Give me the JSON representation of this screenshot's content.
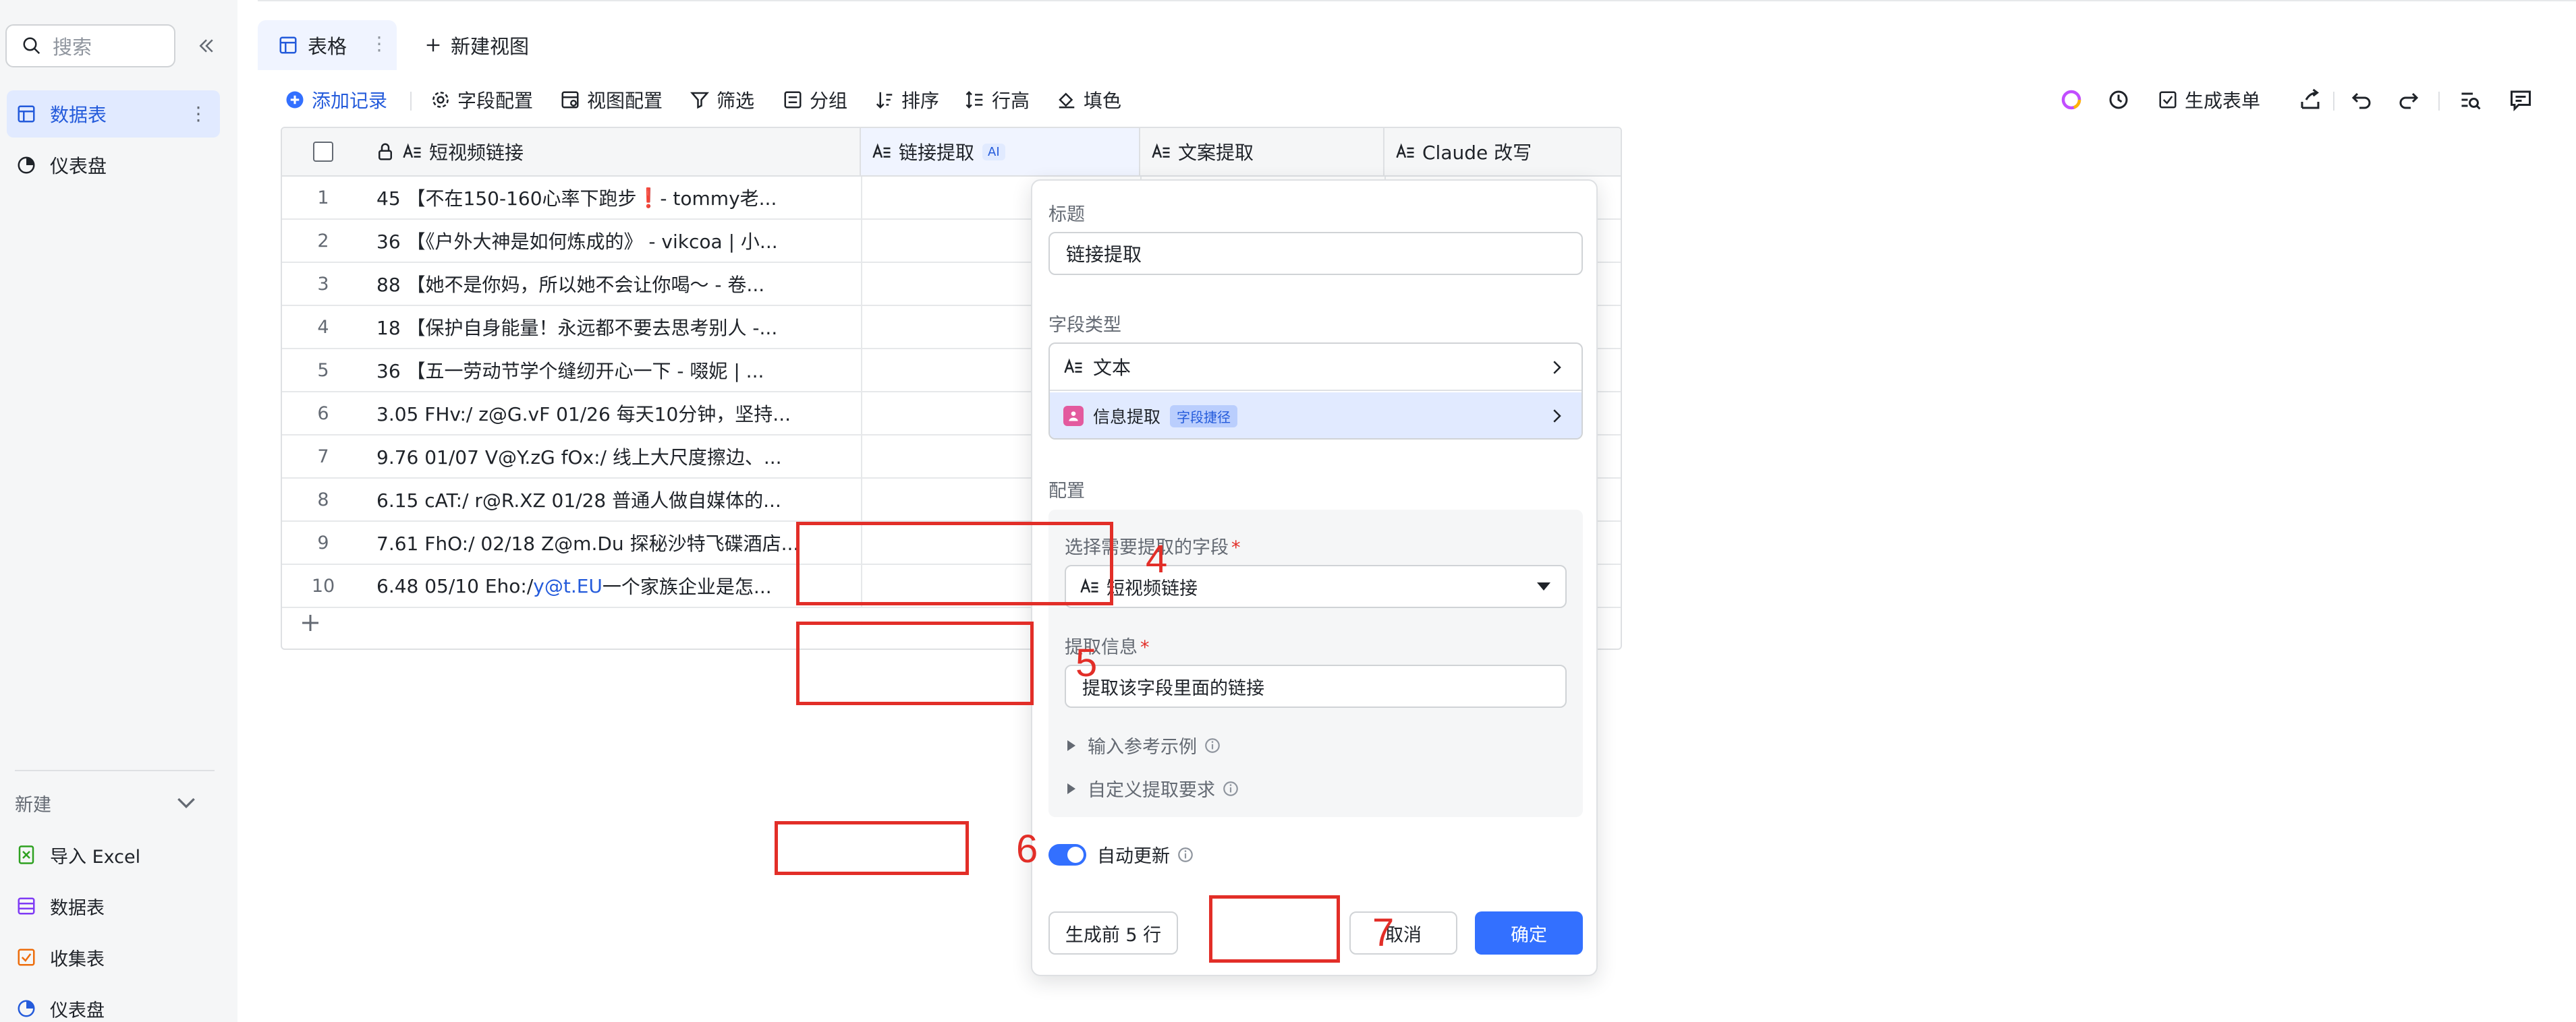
{
  "sidebar": {
    "search_placeholder": "搜索",
    "items": [
      {
        "label": "数据表",
        "active": true
      },
      {
        "label": "仪表盘",
        "active": false
      }
    ],
    "new_section": {
      "label": "新建",
      "items": [
        {
          "label": "导入 Excel",
          "icon": "excel-icon"
        },
        {
          "label": "数据表",
          "icon": "table-icon"
        },
        {
          "label": "收集表",
          "icon": "form-icon"
        },
        {
          "label": "仪表盘",
          "icon": "dashboard-icon"
        }
      ]
    }
  },
  "tabs": {
    "active": "表格",
    "new_view": "新建视图"
  },
  "toolbar": {
    "add_record": "添加记录",
    "field_config": "字段配置",
    "view_config": "视图配置",
    "filter": "筛选",
    "group": "分组",
    "sort": "排序",
    "row_height": "行高",
    "fill": "填色",
    "generate_form": "生成表单"
  },
  "table": {
    "columns": [
      "短视频链接",
      "链接提取",
      "文案提取",
      "Claude 改写"
    ],
    "ai_badge": "AI",
    "rows": [
      {
        "num": "1",
        "text": "45 【不在150-160心率下跑步",
        "excl": "❗",
        "tail": " - tommy老..."
      },
      {
        "num": "2",
        "text": "36 【《户外大神是如何炼成的》 - vikcoa | 小..."
      },
      {
        "num": "3",
        "text": "88 【她不是你妈，所以她不会让你喝～ - 卷..."
      },
      {
        "num": "4",
        "text": "18 【保护自身能量！永远都不要去思考别人 -..."
      },
      {
        "num": "5",
        "text": "36 【五一劳动节学个缝纫开心一下 - 啜妮 | ..."
      },
      {
        "num": "6",
        "text": "3.05 FHv:/ z@G.vF 01/26 每天10分钟，坚持..."
      },
      {
        "num": "7",
        "text": "9.76 01/07 V@Y.zG fOx:/ 线上大尺度擦边、..."
      },
      {
        "num": "8",
        "text": "6.15 cAT:/ r@R.XZ 01/28 普通人做自媒体的..."
      },
      {
        "num": "9",
        "text": "7.61 FhO:/ 02/18 Z@m.Du 探秘沙特飞碟酒店..."
      },
      {
        "num": "10",
        "text": "6.48 05/10 Eho:/ ",
        "link": "y@t.EU",
        "tail": " 一个家族企业是怎..."
      }
    ]
  },
  "panel": {
    "title_label": "标题",
    "title_value": "链接提取",
    "type_label": "字段类型",
    "type_text": "文本",
    "type_extract": "信息提取",
    "type_badge": "字段捷径",
    "config_label": "配置",
    "select_field_label": "选择需要提取的字段",
    "select_field_value": "短视频链接",
    "extract_info_label": "提取信息",
    "extract_info_value": "提取该字段里面的链接",
    "example_label": "输入参考示例",
    "custom_label": "自定义提取要求",
    "auto_update": "自动更新",
    "btn_generate5": "生成前 5 行",
    "btn_cancel": "取消",
    "btn_ok": "确定",
    "required_mark": "*"
  },
  "annotations": [
    "4",
    "5",
    "6",
    "7"
  ],
  "colors": {
    "accent": "#3370ff",
    "annotation_red": "#e22e28",
    "active_bg": "#e1eaff"
  }
}
